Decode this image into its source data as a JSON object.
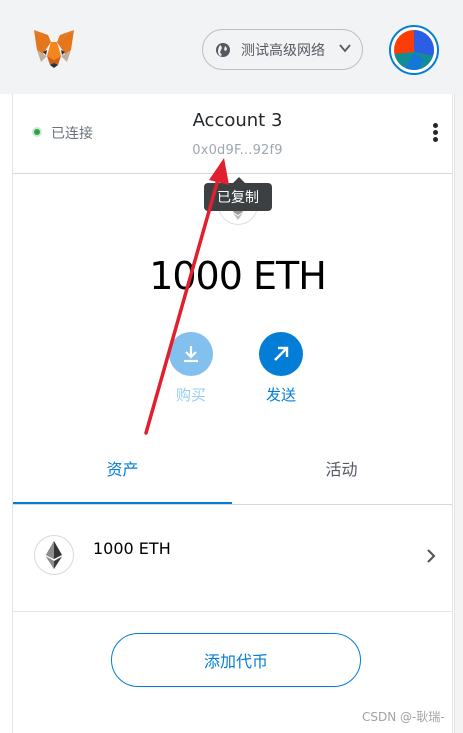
{
  "header": {
    "logo_icon": "metamask-fox-icon",
    "network": {
      "label": "测试高级网络",
      "icon": "globe-icon",
      "chevron": "chevron-down-icon"
    },
    "avatar_icon": "account-avatar-icon"
  },
  "account": {
    "connection_status": "已连接",
    "name": "Account 3",
    "address": "0x0d9F...92f9",
    "menu_icon": "kebab-menu-icon",
    "copied_tooltip": "已复制"
  },
  "balance": {
    "text": "1000 ETH"
  },
  "actions": {
    "buy": {
      "label": "购买",
      "icon": "download-icon"
    },
    "send": {
      "label": "发送",
      "icon": "arrow-up-right-icon"
    }
  },
  "tabs": {
    "assets": "资产",
    "activity": "活动"
  },
  "asset_list": [
    {
      "amount": "1000 ETH",
      "icon": "eth-icon"
    }
  ],
  "add_token_label": "添加代币",
  "watermark": "CSDN @-耿瑞-",
  "colors": {
    "accent": "#037dd6",
    "connected": "#28a745",
    "annotation_arrow": "#e0202e"
  }
}
